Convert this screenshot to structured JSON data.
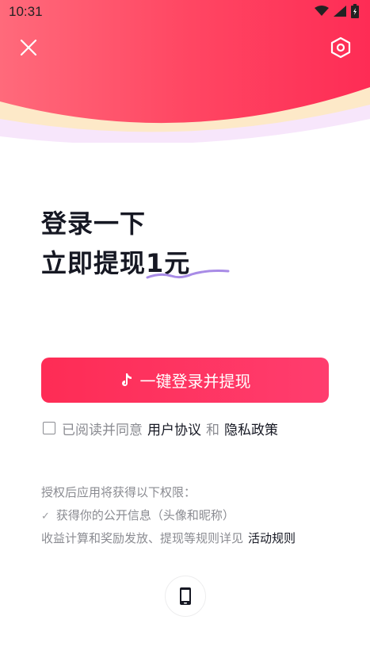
{
  "status_bar": {
    "time": "10:31"
  },
  "headline": {
    "line1": "登录一下",
    "line2_prefix": "立即提现",
    "line2_amount": "1元"
  },
  "login_button": {
    "label": "一键登录并提现"
  },
  "agreement": {
    "prefix": "已阅读并同意",
    "user_agreement": "用户协议",
    "and": "和",
    "privacy_policy": "隐私政策"
  },
  "permissions": {
    "title": "授权后应用将获得以下权限：",
    "item": "获得你的公开信息（头像和昵称）",
    "note": "收益计算和奖励发放、提现等规则详见",
    "rules_link": "活动规则"
  },
  "colors": {
    "accent": "#fe2c55",
    "hero": "#ff4d6d",
    "underline": "#a88be6"
  },
  "icons": [
    "close-icon",
    "settings-hexagon-icon",
    "wifi-icon",
    "signal-icon",
    "battery-icon",
    "tiktok-icon",
    "phone-icon",
    "check-icon"
  ]
}
